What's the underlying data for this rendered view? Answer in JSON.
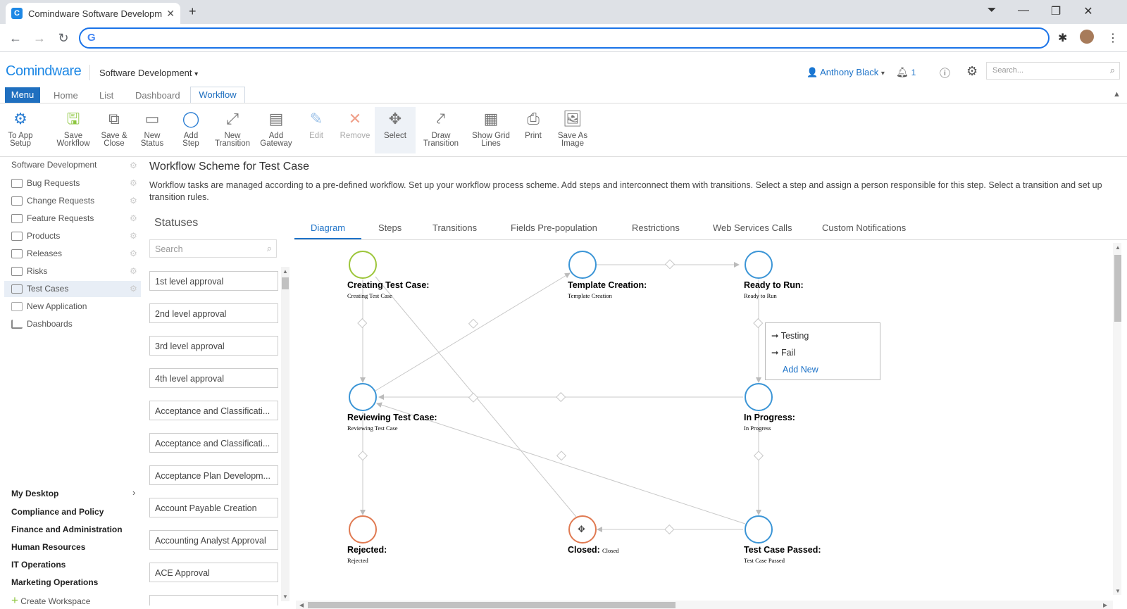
{
  "browser": {
    "tab_title": "Comindware Software Developm",
    "tab_favicon": "C",
    "address": ""
  },
  "app": {
    "logo": "Comindware",
    "workspace": "Software Development",
    "user": "Anthony Black",
    "notifications": "1",
    "search_placeholder": "Search..."
  },
  "menu": {
    "menu_label": "Menu",
    "tabs": [
      "Home",
      "List",
      "Dashboard",
      "Workflow"
    ]
  },
  "ribbon": [
    {
      "l1": "To App",
      "l2": "Setup"
    },
    {
      "l1": "Save",
      "l2": "Workflow"
    },
    {
      "l1": "Save &",
      "l2": "Close"
    },
    {
      "l1": "New",
      "l2": "Status"
    },
    {
      "l1": "Add",
      "l2": "Step"
    },
    {
      "l1": "New",
      "l2": "Transition"
    },
    {
      "l1": "Add",
      "l2": "Gateway"
    },
    {
      "l1": "Edit",
      "l2": ""
    },
    {
      "l1": "Remove",
      "l2": ""
    },
    {
      "l1": "Select",
      "l2": ""
    },
    {
      "l1": "Draw",
      "l2": "Transition"
    },
    {
      "l1": "Show Grid",
      "l2": "Lines"
    },
    {
      "l1": "Print",
      "l2": ""
    },
    {
      "l1": "Save As",
      "l2": "Image"
    }
  ],
  "leftnav": {
    "root": "Software Development",
    "items": [
      "Bug Requests",
      "Change Requests",
      "Feature Requests",
      "Products",
      "Releases",
      "Risks",
      "Test Cases",
      "New Application",
      "Dashboards"
    ],
    "workspaces": [
      "My Desktop",
      "Compliance and Policy",
      "Finance and Administration",
      "Human Resources",
      "IT Operations",
      "Marketing Operations"
    ],
    "create": "Create Workspace"
  },
  "page": {
    "title": "Workflow Scheme for Test Case",
    "description": "Workflow tasks are managed according to a pre-defined workflow. Set up your workflow process scheme. Add steps and interconnect them with transitions. Select a step and assign a person responsible for this step. Select a transition and set up transition rules."
  },
  "statuses": {
    "heading": "Statuses",
    "search_placeholder": "Search",
    "items": [
      "1st level approval",
      "2nd level approval",
      "3rd level approval",
      "4th level approval",
      "Acceptance and Classificati...",
      "Acceptance and Classificati...",
      "Acceptance Plan Developm...",
      "Account Payable Creation",
      "Accounting Analyst Approval",
      "ACE Approval"
    ]
  },
  "diagram_tabs": [
    "Diagram",
    "Steps",
    "Transitions",
    "Fields Pre-population",
    "Restrictions",
    "Web Services Calls",
    "Custom Notifications"
  ],
  "diagram": {
    "nodes": [
      {
        "title": "Creating Test Case:",
        "sub": "Creating Test Case",
        "color": "#9dc63b"
      },
      {
        "title": "Template Creation:",
        "sub": "Template Creation",
        "color": "#3b95d6"
      },
      {
        "title": "Ready to Run:",
        "sub": "Ready to Run",
        "color": "#3b95d6"
      },
      {
        "title": "Reviewing Test Case:",
        "sub": "Reviewing Test Case",
        "color": "#3b95d6"
      },
      {
        "title": "In Progress:",
        "sub": "In Progress",
        "color": "#3b95d6"
      },
      {
        "title": "Rejected:",
        "sub": "Rejected",
        "color": "#e07a52"
      },
      {
        "title": "Closed:",
        "sub": "Closed",
        "color": "#e07a52"
      },
      {
        "title": "Test Case Passed:",
        "sub": "Test Case Passed",
        "color": "#3b95d6"
      }
    ],
    "popup": [
      "Testing",
      "Fail"
    ],
    "popup_add": "Add New"
  }
}
